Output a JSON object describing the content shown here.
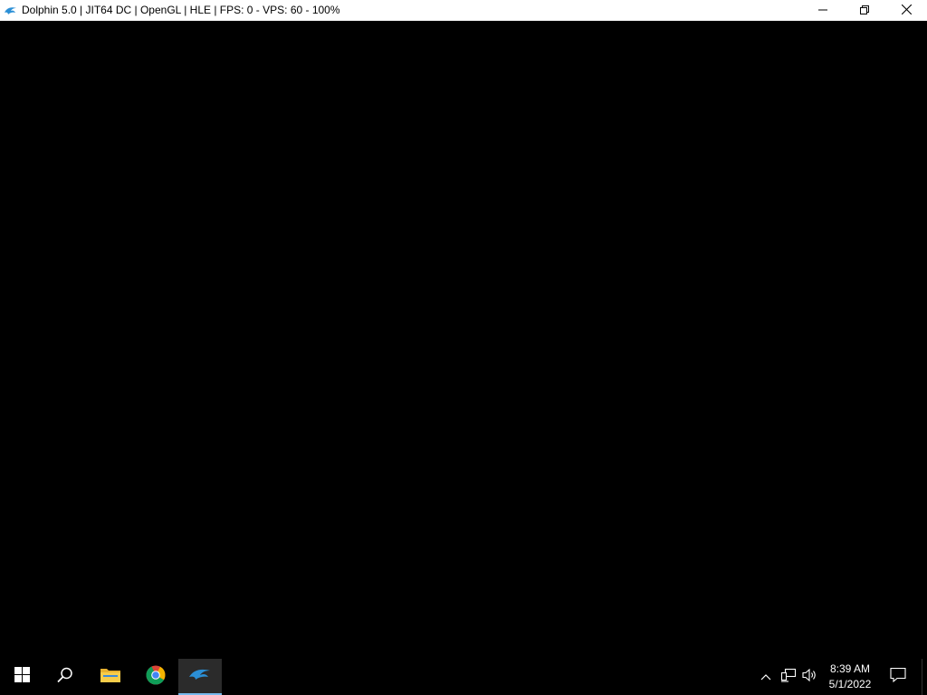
{
  "window": {
    "title": "Dolphin 5.0 | JIT64 DC | OpenGL | HLE | FPS: 0 - VPS: 60 - 100%",
    "icon": "dolphin-icon",
    "controls": [
      "minimize-icon",
      "restore-icon",
      "close-icon"
    ]
  },
  "taskbar": {
    "start_icon": "windows-logo-icon",
    "search_icon": "search-icon",
    "pinned": [
      {
        "name": "file-explorer",
        "icon": "folder-icon"
      },
      {
        "name": "chrome",
        "icon": "chrome-icon"
      },
      {
        "name": "dolphin",
        "icon": "dolphin-icon",
        "active": true
      }
    ],
    "tray_icons": [
      "chevron-up-icon",
      "network-icon",
      "volume-icon"
    ],
    "clock": {
      "time": "8:39 AM",
      "date": "5/1/2022"
    },
    "notification_icon": "action-center-icon"
  },
  "colors": {
    "titlebar_bg": "#ffffff",
    "render_bg": "#000000",
    "taskbar_bg": "#000000",
    "active_indicator": "#76b9ed",
    "dolphin_blue": "#2b8fd6"
  }
}
